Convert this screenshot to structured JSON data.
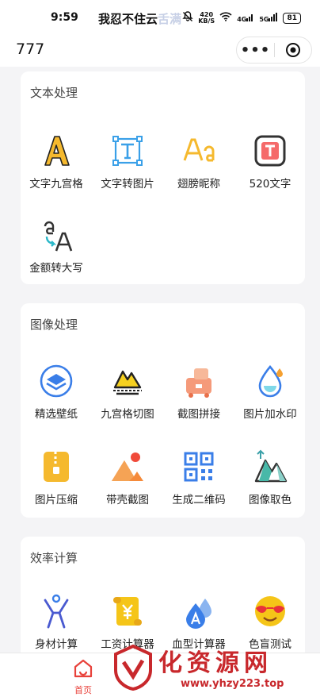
{
  "status_bar": {
    "time": "9:59",
    "marquee_text": "我忍不住云",
    "marquee_fade": "舌满",
    "net_speed_value": "420",
    "net_speed_unit": "KB/S",
    "signal_4g": "4G",
    "signal_5g": "5G",
    "battery": "81"
  },
  "nav": {
    "title": "777",
    "more_label": "•••"
  },
  "sections": [
    {
      "title": "文本处理",
      "items": [
        {
          "label": "文字九宫格",
          "icon": "letter-a-icon"
        },
        {
          "label": "文字转图片",
          "icon": "text-frame-icon"
        },
        {
          "label": "翅膀昵称",
          "icon": "font-aa-icon"
        },
        {
          "label": "520文字",
          "icon": "text-box-icon"
        },
        {
          "label": "金额转大写",
          "icon": "translate-icon"
        }
      ]
    },
    {
      "title": "图像处理",
      "items": [
        {
          "label": "精选壁纸",
          "icon": "layers-icon"
        },
        {
          "label": "九宫格切图",
          "icon": "mountain-crop-icon"
        },
        {
          "label": "截图拼接",
          "icon": "puzzle-icon"
        },
        {
          "label": "图片加水印",
          "icon": "water-drop-icon"
        },
        {
          "label": "图片压缩",
          "icon": "zip-file-icon"
        },
        {
          "label": "带壳截图",
          "icon": "landscape-icon"
        },
        {
          "label": "生成二维码",
          "icon": "qr-code-icon"
        },
        {
          "label": "图像取色",
          "icon": "color-picker-icon"
        }
      ]
    },
    {
      "title": "效率计算",
      "items": [
        {
          "label": "身材计算",
          "icon": "body-figure-icon"
        },
        {
          "label": "工资计算器",
          "icon": "salary-scroll-icon"
        },
        {
          "label": "血型计算器",
          "icon": "blood-drop-icon"
        },
        {
          "label": "色盲测试",
          "icon": "emoji-sunglasses-icon"
        }
      ]
    }
  ],
  "tabbar": {
    "home_label": "首页"
  },
  "watermark": {
    "text": "化资源网",
    "url": "www.yhzy223.top"
  },
  "colors": {
    "accent_red": "#e8413a",
    "yellow": "#f5b92e",
    "blue": "#3a7ee8"
  }
}
